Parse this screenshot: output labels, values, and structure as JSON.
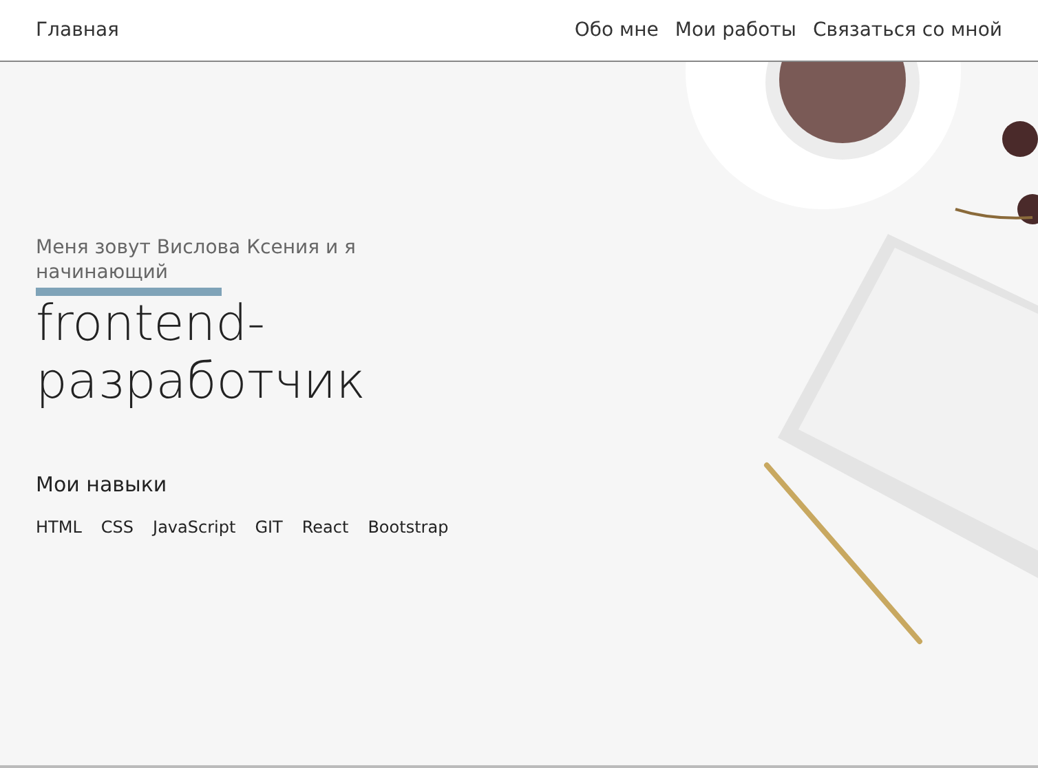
{
  "header": {
    "home_link": "Главная",
    "nav": [
      "Обо мне",
      "Мои работы",
      "Связаться со мной"
    ]
  },
  "hero": {
    "intro": "Меня зовут Вислова Ксения и я начинающий",
    "title": "frontend-разработчик",
    "skills_heading": "Мои навыки",
    "skills": [
      "HTML",
      "CSS",
      "JavaScript",
      "GIT",
      "React",
      "Bootstrap"
    ]
  }
}
